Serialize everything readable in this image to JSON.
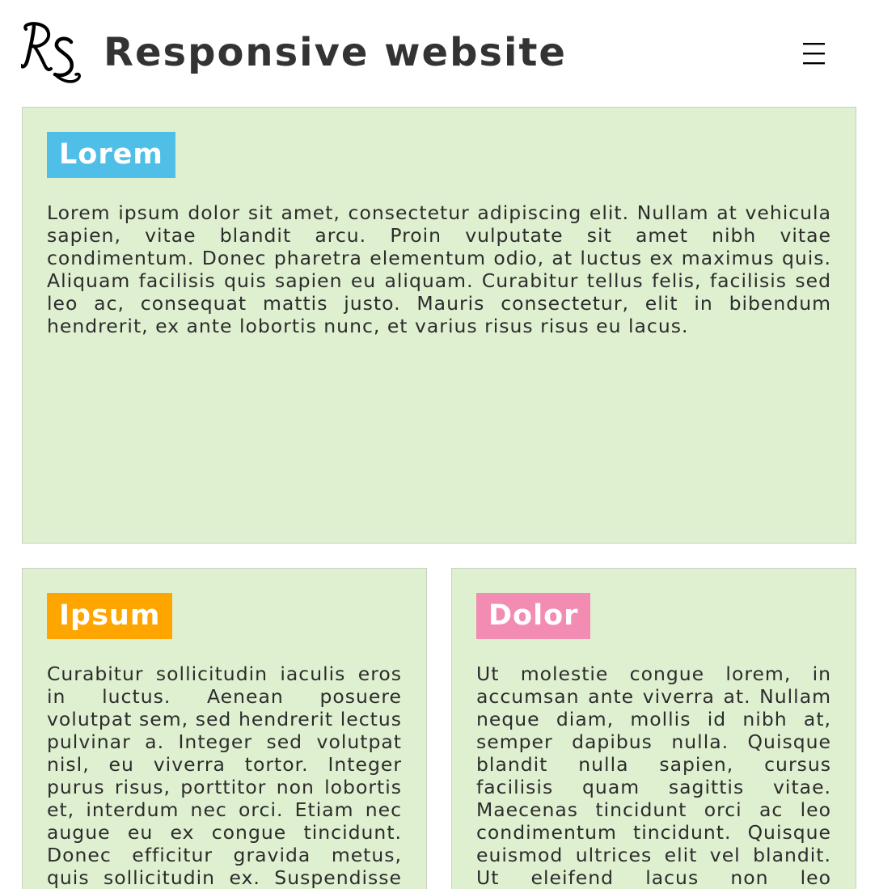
{
  "header": {
    "logo_text": "RS",
    "title": "Responsive website",
    "menu_icon": "hamburger-menu-icon"
  },
  "colors": {
    "card_background": "#dff0d0",
    "badge_lorem": "#4fbfe8",
    "badge_ipsum": "#ffa500",
    "badge_dolor": "#f38cb2",
    "text": "#333333"
  },
  "sections": [
    {
      "heading": "Lorem",
      "body": "Lorem ipsum dolor sit amet, consectetur adipiscing elit. Nullam at vehicula sapien, vitae blandit arcu. Proin vulputate sit amet nibh vitae condimentum. Donec pharetra elementum odio, at luctus ex maximus quis. Aliquam facilisis quis sapien eu aliquam. Curabitur tellus felis, facilisis sed leo ac, consequat mattis justo. Mauris consectetur, elit in bibendum hendrerit, ex ante lobortis nunc, et varius risus risus eu lacus."
    },
    {
      "heading": "Ipsum",
      "body": "Curabitur sollicitudin iaculis eros in luctus. Aenean posuere volutpat sem, sed hendrerit lectus pulvinar a. Integer sed volutpat nisl, eu viverra tortor. Integer purus risus, porttitor non lobortis et, interdum nec orci. Etiam nec augue eu ex congue tincidunt. Donec efficitur gravida metus, quis sollicitudin ex. Suspendisse bibendum libero turpis,"
    },
    {
      "heading": "Dolor",
      "body": "Ut molestie congue lorem, in accumsan ante viverra at. Nullam neque diam, mollis id nibh at, semper dapibus nulla. Quisque blandit nulla sapien, cursus facilisis quam sagittis vitae. Maecenas tincidunt orci ac leo condimentum tincidunt. Quisque euismod ultrices elit vel blandit. Ut eleifend lacus non leo ullamcorper efficitur eu nec"
    }
  ]
}
